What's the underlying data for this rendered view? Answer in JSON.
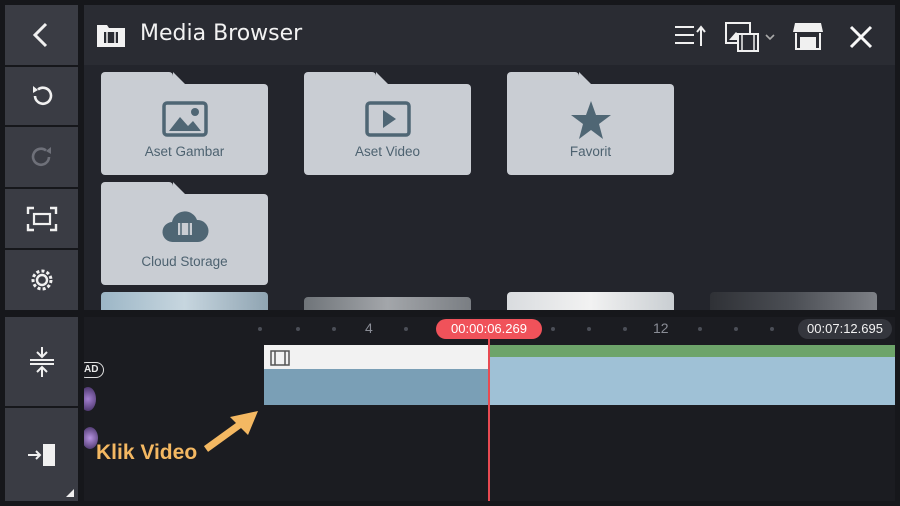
{
  "header": {
    "title": "Media Browser"
  },
  "folders": [
    {
      "label": "Aset Gambar",
      "icon": "image-icon"
    },
    {
      "label": "Aset Video",
      "icon": "play-icon"
    },
    {
      "label": "Favorit",
      "icon": "star-icon"
    },
    {
      "label": "Cloud Storage",
      "icon": "cloud-film-icon"
    }
  ],
  "timeline": {
    "tick_4": "4",
    "tick_12": "12",
    "playhead_time": "00:00:06.269",
    "total_time": "00:07:12.695",
    "clip_badge": "AD"
  },
  "annotation": {
    "text": "Klik Video"
  },
  "colors": {
    "accent": "#f0525a",
    "annotation": "#f4b862",
    "toolbar": "#3a3c44",
    "folder": "#c9cdd3"
  }
}
